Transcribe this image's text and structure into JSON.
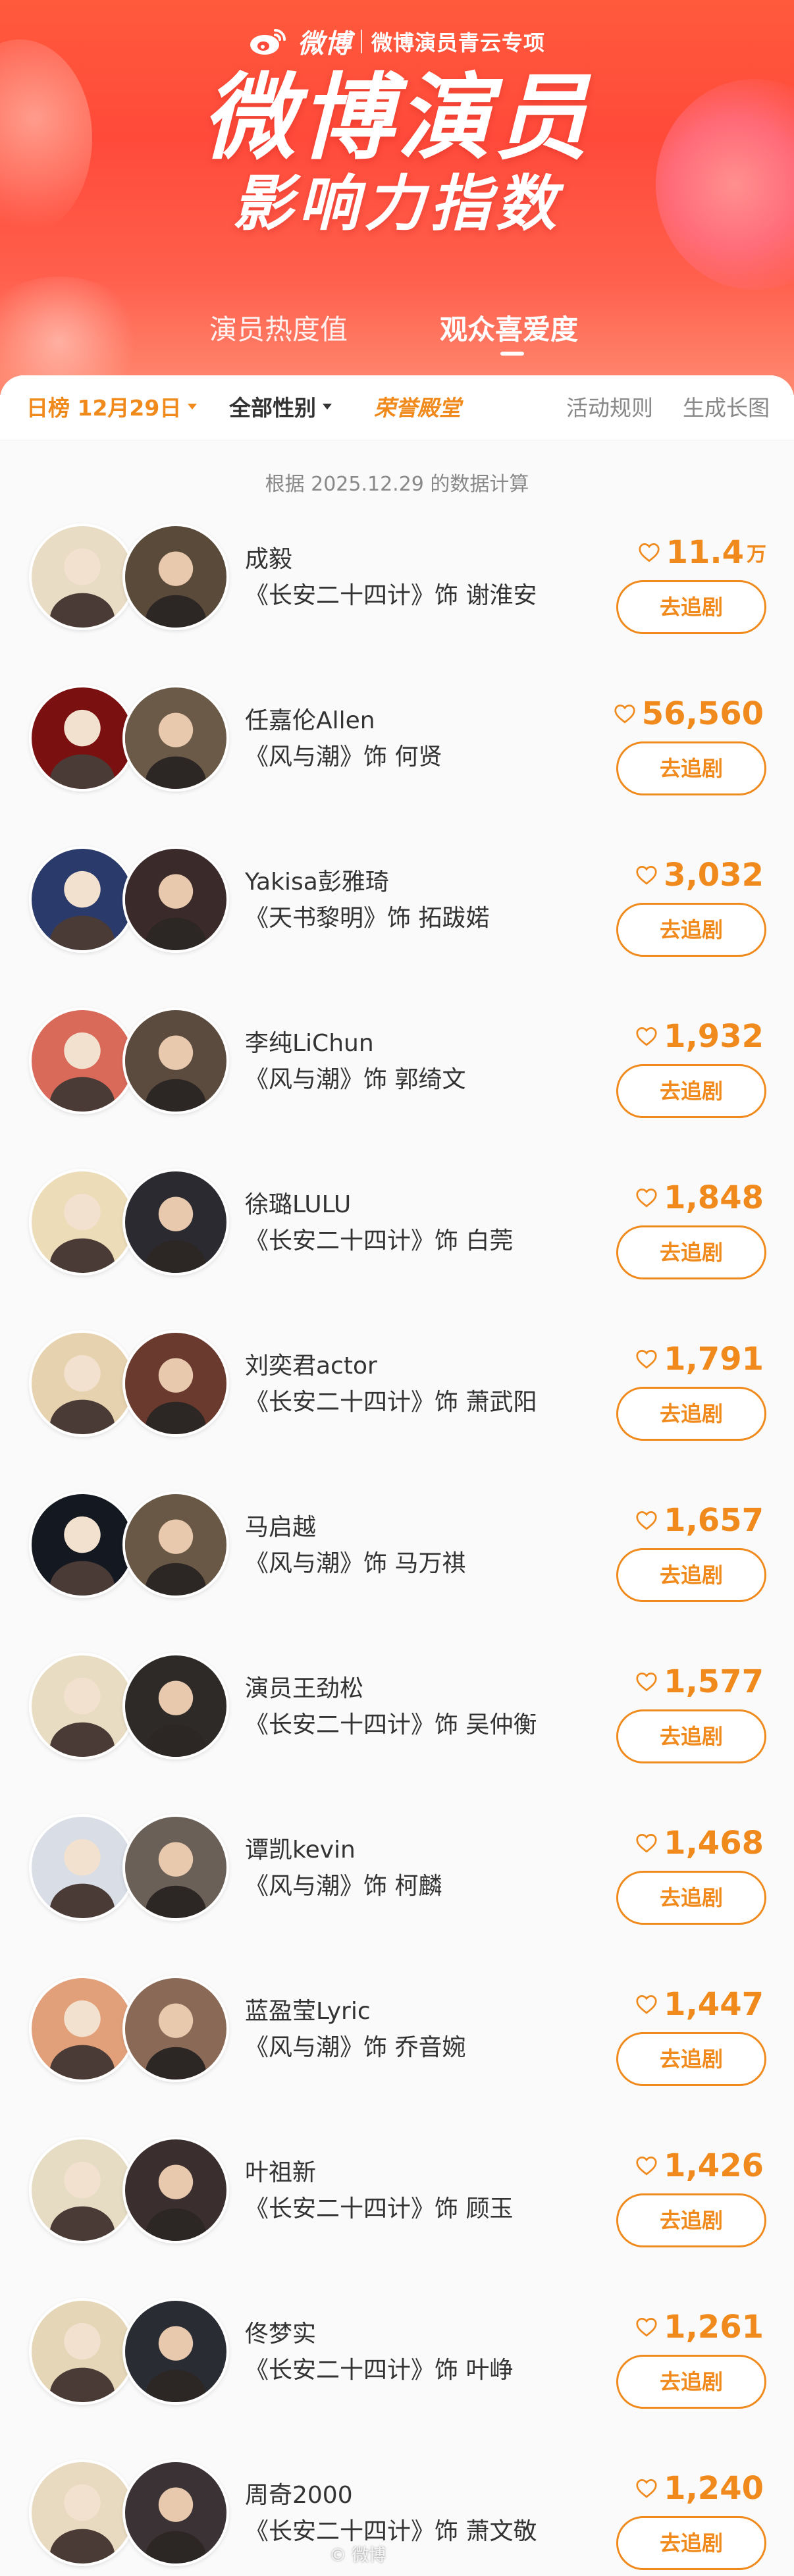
{
  "header": {
    "brand_name": "微博",
    "brand_sub": "微博演员青云专项",
    "title": "微博演员",
    "subtitle": "影响力指数",
    "tabs": [
      {
        "label": "演员热度值",
        "active": false
      },
      {
        "label": "观众喜爱度",
        "active": true
      }
    ]
  },
  "filters": {
    "date_label": "日榜 12月29日",
    "gender_label": "全部性别",
    "hall_label": "荣誉殿堂",
    "rules_label": "活动规则",
    "long_image_label": "生成长图"
  },
  "calc_note": "根据 2025.12.29 的数据计算",
  "colors": {
    "accent": "#f08a1c",
    "hero": "#ff4a3a"
  },
  "chase_label": "去追剧",
  "actors": [
    {
      "name": "成毅",
      "role": "《长安二十四计》饰 谢淮安",
      "score": "11.4",
      "unit": "万",
      "avatar_colors": [
        "#e9dcc4",
        "#5a4a3a"
      ]
    },
    {
      "name": "任嘉伦Allen",
      "role": "《风与潮》饰 何贤",
      "score": "56,560",
      "unit": "",
      "avatar_colors": [
        "#7a1010",
        "#6b5a48"
      ]
    },
    {
      "name": "Yakisa彭雅琦",
      "role": "《天书黎明》饰 拓跋婼",
      "score": "3,032",
      "unit": "",
      "avatar_colors": [
        "#2a3a6a",
        "#3b2a2a"
      ]
    },
    {
      "name": "李纯LiChun",
      "role": "《风与潮》饰 郭绮文",
      "score": "1,932",
      "unit": "",
      "avatar_colors": [
        "#d96a5a",
        "#5b4a3e"
      ]
    },
    {
      "name": "徐璐LULU",
      "role": "《长安二十四计》饰 白莞",
      "score": "1,848",
      "unit": "",
      "avatar_colors": [
        "#ecdcb8",
        "#2b2a30"
      ]
    },
    {
      "name": "刘奕君actor",
      "role": "《长安二十四计》饰 萧武阳",
      "score": "1,791",
      "unit": "",
      "avatar_colors": [
        "#e6d2ae",
        "#6a3a2e"
      ]
    },
    {
      "name": "马启越",
      "role": "《风与潮》饰 马万祺",
      "score": "1,657",
      "unit": "",
      "avatar_colors": [
        "#141820",
        "#6a5846"
      ]
    },
    {
      "name": "演员王劲松",
      "role": "《长安二十四计》饰 吴仲衡",
      "score": "1,577",
      "unit": "",
      "avatar_colors": [
        "#e8dcc2",
        "#2e2a28"
      ]
    },
    {
      "name": "谭凯kevin",
      "role": "《风与潮》饰 柯麟",
      "score": "1,468",
      "unit": "",
      "avatar_colors": [
        "#d8dde6",
        "#6a6058"
      ]
    },
    {
      "name": "蓝盈莹Lyric",
      "role": "《风与潮》饰 乔音婉",
      "score": "1,447",
      "unit": "",
      "avatar_colors": [
        "#e2a07a",
        "#8a6a56"
      ]
    },
    {
      "name": "叶祖新",
      "role": "《长安二十四计》饰 顾玉",
      "score": "1,426",
      "unit": "",
      "avatar_colors": [
        "#e6dcc4",
        "#3a2e2e"
      ]
    },
    {
      "name": "佟梦实",
      "role": "《长安二十四计》饰 叶峥",
      "score": "1,261",
      "unit": "",
      "avatar_colors": [
        "#e4d6b6",
        "#2a2c34"
      ]
    },
    {
      "name": "周奇2000",
      "role": "《长安二十四计》饰 萧文敬",
      "score": "1,240",
      "unit": "",
      "avatar_colors": [
        "#e8dac0",
        "#3a3234"
      ]
    }
  ]
}
